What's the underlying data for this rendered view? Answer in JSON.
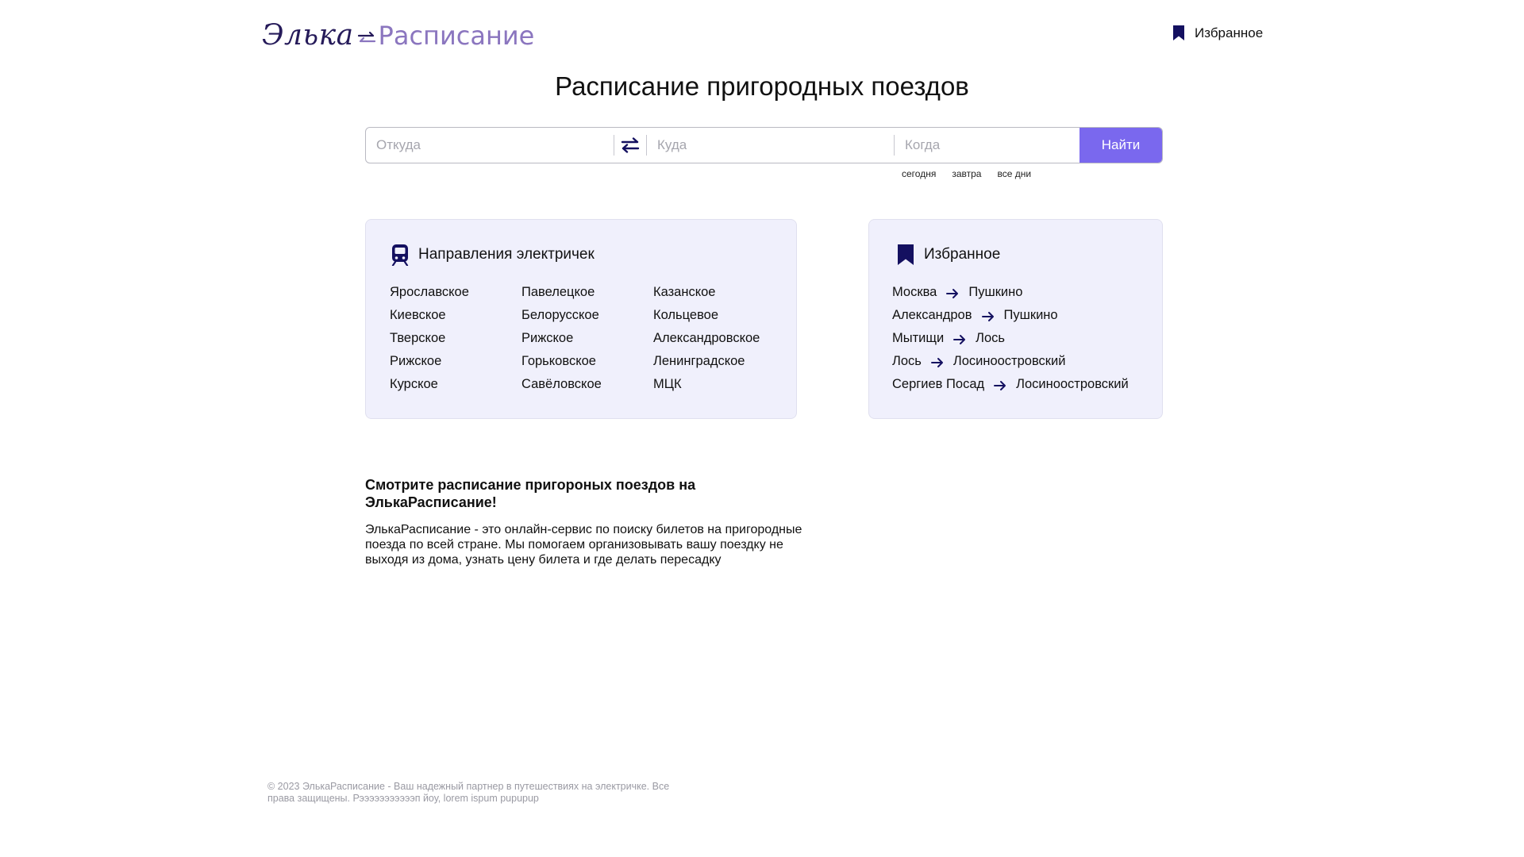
{
  "header": {
    "logo_part1": "Элька",
    "logo_part2": "Расписание",
    "favorites_label": "Избранное"
  },
  "page_title": "Расписание пригородных поездов",
  "search": {
    "from_placeholder": "Откуда",
    "to_placeholder": "Куда",
    "when_placeholder": "Когда",
    "button_label": "Найти",
    "quick_dates": [
      "сегодня",
      "завтра",
      "все дни"
    ]
  },
  "directions": {
    "title": "Направления электричек",
    "items": [
      "Ярославское",
      "Павелецкое",
      "Казанское",
      "Киевское",
      "Белорусское",
      "Кольцевое",
      "Тверское",
      "Рижское",
      "Александровское",
      "Рижское",
      "Горьковское",
      "Ленинградское",
      "Курское",
      "Савёловское",
      "МЦК"
    ]
  },
  "favorites": {
    "title": "Избранное",
    "routes": [
      {
        "from": "Москва",
        "to": "Пушкино"
      },
      {
        "from": "Александров",
        "to": "Пушкино"
      },
      {
        "from": "Мытищи",
        "to": "Лось"
      },
      {
        "from": "Лось",
        "to": "Лосиноостровский"
      },
      {
        "from": "Сергиев Посад",
        "to": "Лосиноостровский"
      }
    ]
  },
  "about": {
    "title": "Смотрите расписание пригороных поездов на ЭлькаРасписание!",
    "text": "ЭлькаРасписание - это онлайн-сервис по поиску билетов на пригородные поезда по всей стране. Мы помогаем организовывать вашу поездку не выходя из дома, узнать цену билета и где делать пересадку"
  },
  "footer": {
    "text": "© 2023 ЭлькаРасписание - Ваш надежный партнер в путешествиях на электричке. Все права защищены. Рэээээээээээп йоу, lorem ispum pupupup"
  },
  "colors": {
    "accent": "#7a68ee",
    "logo_dark": "#261b5a",
    "logo_light": "#8b76bf",
    "card_bg": "#f0f0fc",
    "icon_navy": "#141060"
  },
  "icons": {
    "header_favorites": "bookmark-icon",
    "swap": "swap-arrows-icon",
    "directions": "train-icon",
    "favorites": "bookmark-icon",
    "route_arrow": "arrow-right-icon"
  }
}
